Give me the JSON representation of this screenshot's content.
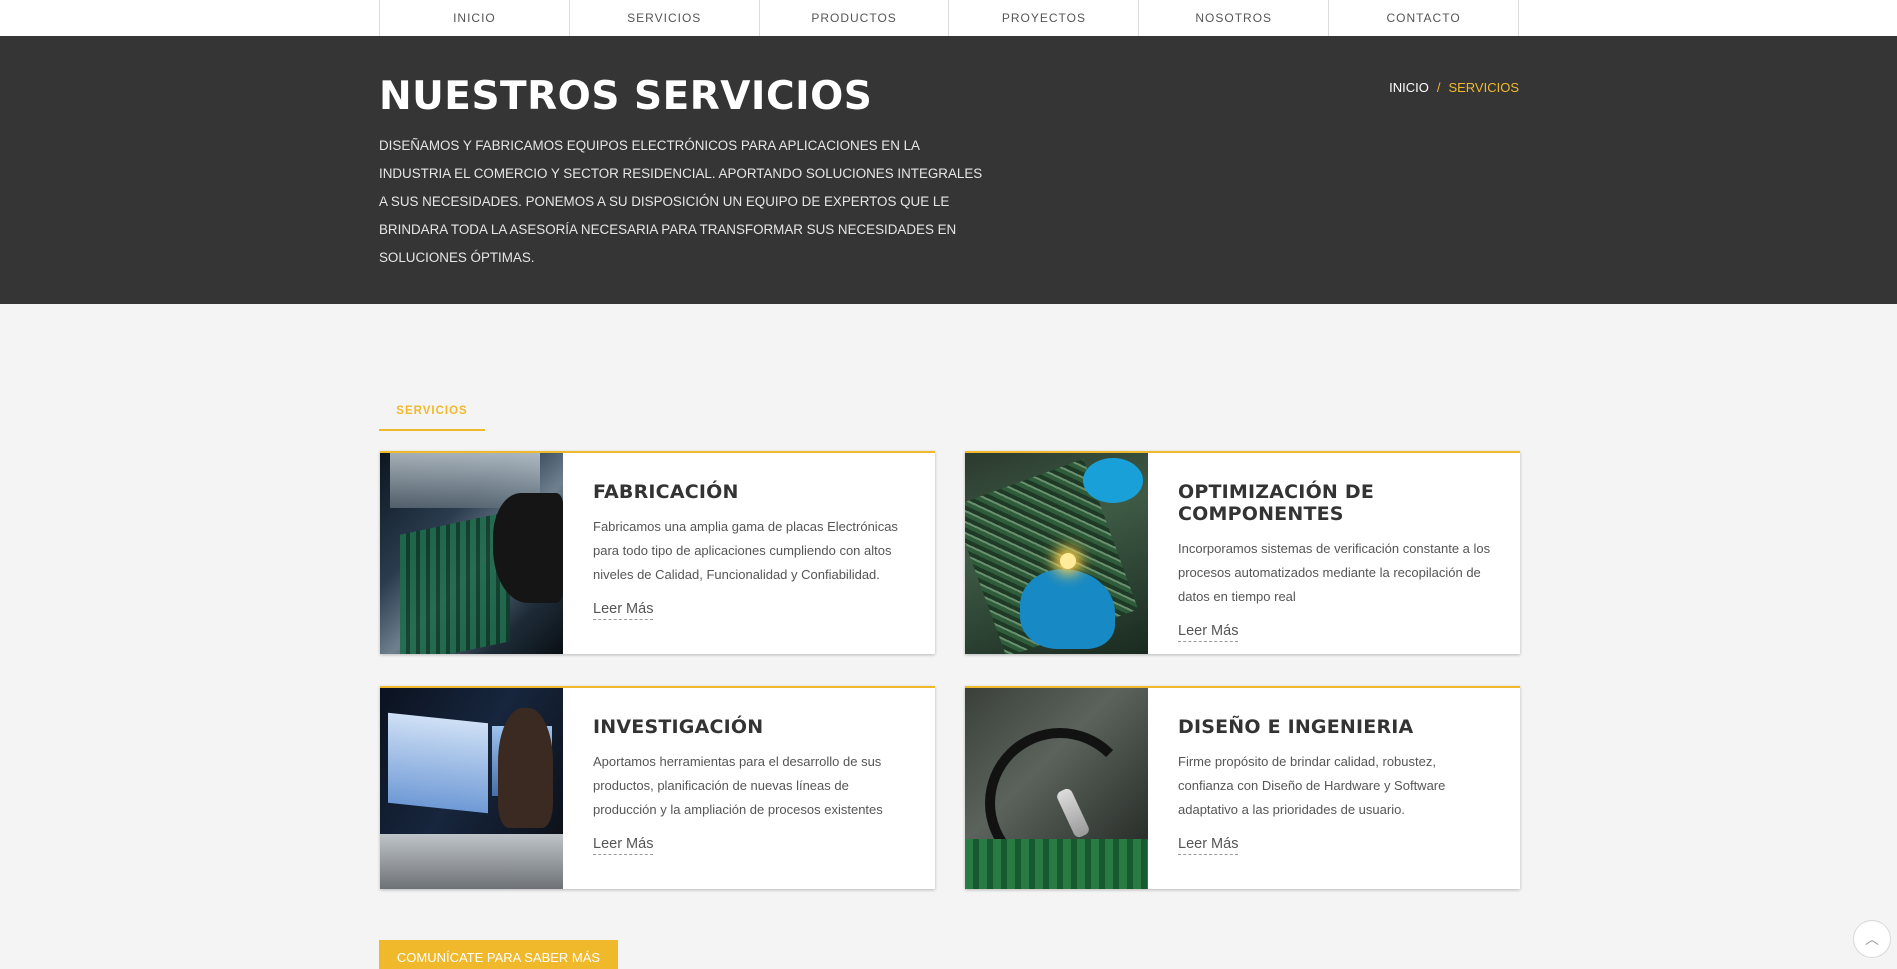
{
  "nav": {
    "items": [
      {
        "label": "INICIO"
      },
      {
        "label": "SERVICIOS"
      },
      {
        "label": "PRODUCTOS"
      },
      {
        "label": "PROYECTOS"
      },
      {
        "label": "NOSOTROS"
      },
      {
        "label": "CONTACTO"
      }
    ]
  },
  "hero": {
    "title": "NUESTROS SERVICIOS",
    "description": "DISEÑAMOS Y FABRICAMOS EQUIPOS ELECTRÓNICOS PARA APLICACIONES EN LA INDUSTRIA EL COMERCIO Y SECTOR RESIDENCIAL. APORTANDO SOLUCIONES INTEGRALES A SUS NECESIDADES. PONEMOS A SU DISPOSICIÓN UN EQUIPO DE EXPERTOS QUE LE BRINDARA TODA LA ASESORÍA NECESARIA PARA TRANSFORMAR SUS NECESIDADES EN SOLUCIONES ÓPTIMAS.",
    "breadcrumb": {
      "home": "INICIO",
      "separator": "/",
      "current": "SERVICIOS"
    }
  },
  "section": {
    "tab_label": "SERVICIOS"
  },
  "cards": [
    {
      "title": "FABRICACIÓN",
      "text": "Fabricamos una amplia gama de placas Electrónicas para todo tipo de aplicaciones cumpliendo con altos niveles de Calidad, Funcionalidad y Confiabilidad.",
      "link": "Leer Más"
    },
    {
      "title": "OPTIMIZACIÓN DE COMPONENTES",
      "text": "Incorporamos sistemas de verificación constante a los procesos automatizados mediante la recopilación de datos en tiempo real",
      "link": "Leer Más"
    },
    {
      "title": "INVESTIGACIÓN",
      "text": "Aportamos herramientas para el desarrollo de sus productos, planificación de nuevas líneas de producción y la ampliación de procesos existentes",
      "link": "Leer Más"
    },
    {
      "title": "DISEÑO E INGENIERIA",
      "text": "Firme propósito de brindar calidad, robustez, confianza con Diseño de Hardware y Software adaptativo a las prioridades de usuario.",
      "link": "Leer Más"
    }
  ],
  "cta": {
    "label": "COMUNÍCATE PARA SABER MÁS"
  },
  "back_to_top": {
    "icon": "chevron-up-icon",
    "glyph": "︿"
  },
  "colors": {
    "accent": "#f0b92b",
    "hero_bg": "#353535",
    "page_bg": "#f4f4f4"
  }
}
